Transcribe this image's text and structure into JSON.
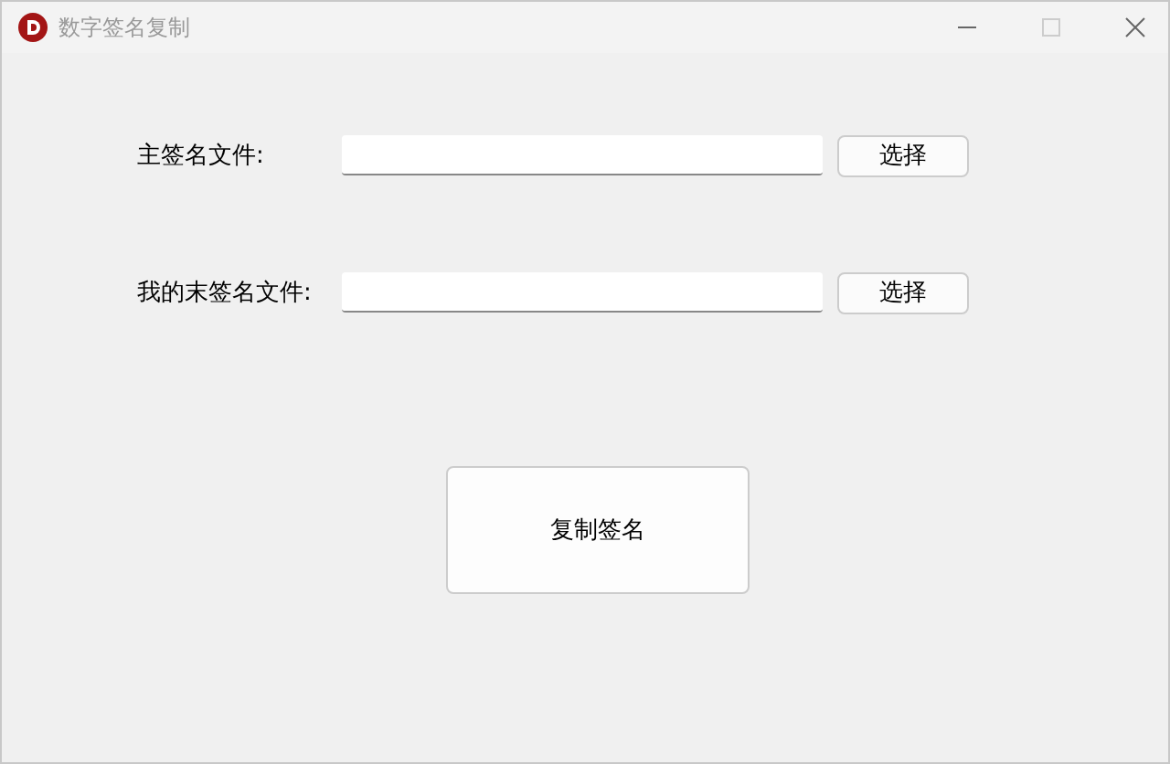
{
  "window": {
    "title": "数字签名复制"
  },
  "rows": [
    {
      "label": "主签名文件:",
      "button": "选择"
    },
    {
      "label": "我的末签名文件:",
      "button": "选择"
    }
  ],
  "main_button": "复制签名"
}
